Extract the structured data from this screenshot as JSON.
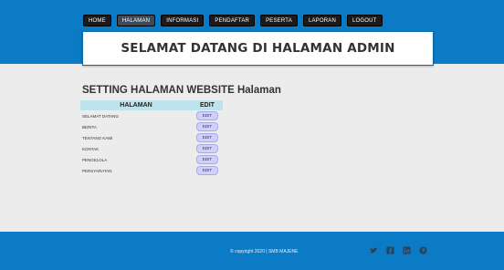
{
  "nav": {
    "items": [
      "HOME",
      "HALAMAN",
      "INFORMASI",
      "PENDAFTAR",
      "PESERTA",
      "LAPORAN",
      "LOGOUT"
    ],
    "active": "HALAMAN"
  },
  "banner": {
    "title": "SELAMAT DATANG DI HALAMAN ADMIN"
  },
  "main": {
    "heading": "SETTING HALAMAN WEBSITE Halaman",
    "table": {
      "headers": [
        "HALAMAN",
        "EDIT"
      ],
      "rows": [
        {
          "name": "SELAMAT DATANG",
          "action": "EDIT"
        },
        {
          "name": "BERITA",
          "action": "EDIT"
        },
        {
          "name": "TENTANG KAMI",
          "action": "EDIT"
        },
        {
          "name": "KONTAK",
          "action": "EDIT"
        },
        {
          "name": "PENGELOLA",
          "action": "EDIT"
        },
        {
          "name": "PERSYARATAN",
          "action": "EDIT"
        }
      ]
    }
  },
  "footer": {
    "copyright": "© copyright 2020 | SMB MAJENE",
    "social": [
      "twitter-icon",
      "facebook-icon",
      "linkedin-icon",
      "pinterest-icon"
    ]
  },
  "colors": {
    "header_bg": "#0b7bc6",
    "nav_button": "#1b1b1b",
    "nav_active": "#3d4a59",
    "table_header": "#bde3ec",
    "edit_button": "#cfd0fb",
    "page_bg": "#ececec"
  }
}
